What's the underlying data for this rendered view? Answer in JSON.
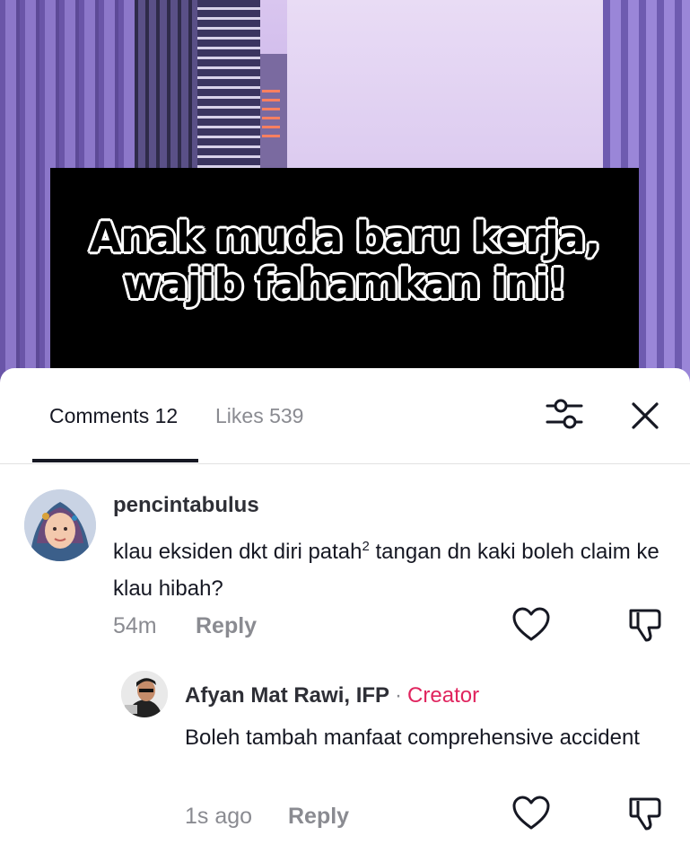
{
  "video": {
    "caption_line1": "Anak muda baru kerja,",
    "caption_line2": "wajib fahamkan ini!"
  },
  "tabs": {
    "comments_label": "Comments 12",
    "likes_label": "Likes 539"
  },
  "icons": {
    "filter": "sliders-icon",
    "close": "close-icon",
    "like": "heart-icon",
    "dislike": "thumbs-down-icon"
  },
  "comments": [
    {
      "username": "pencintabulus",
      "text_before": "klau eksiden dkt diri patah",
      "superscript": "2",
      "text_after": " tangan dn kaki boleh claim ke klau hibah?",
      "time": "54m",
      "reply_label": "Reply"
    },
    {
      "username": "Afyan Mat Rawi, IFP",
      "separator": "·",
      "badge": "Creator",
      "text": "Boleh tambah manfaat comprehensive accident",
      "time": "1s ago",
      "reply_label": "Reply"
    }
  ],
  "colors": {
    "creator_badge": "#e0245e",
    "primary_text": "#161823",
    "secondary_text": "#8a8b91"
  }
}
